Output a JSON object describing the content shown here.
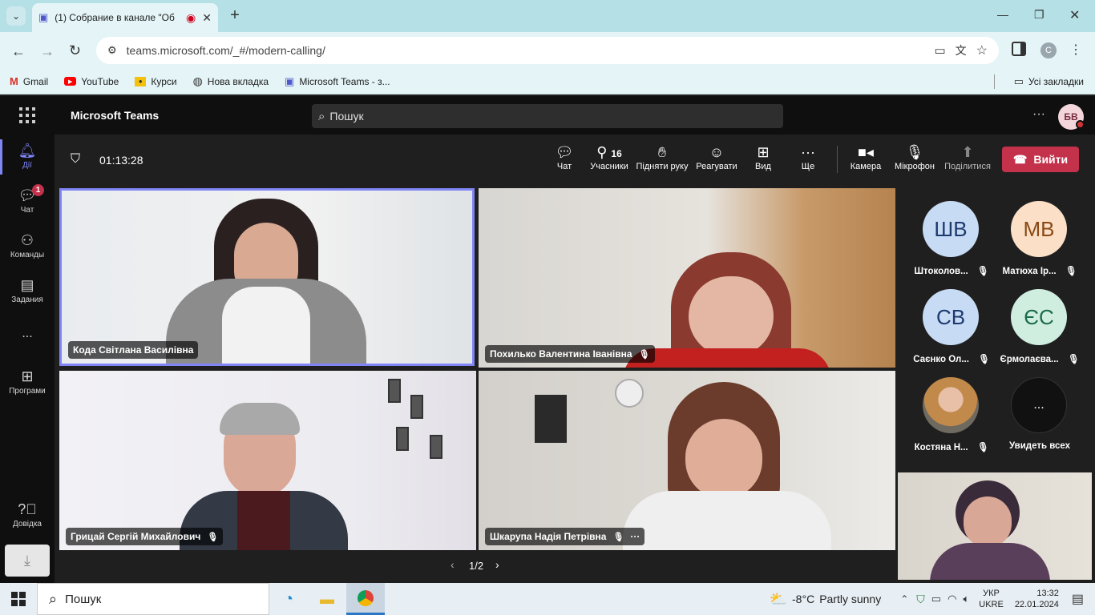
{
  "browser": {
    "tab_title": "(1) Собрание в канале \"Об",
    "new_tab": "+",
    "url": "teams.microsoft.com/_#/modern-calling/",
    "profile_initial": "C",
    "bookmarks": [
      "Gmail",
      "YouTube",
      "Курси",
      "Нова вкладка",
      "Microsoft Teams - з..."
    ],
    "all_bookmarks": "Усі закладки"
  },
  "teams": {
    "app_title": "Microsoft Teams",
    "search_placeholder": "Пошук",
    "user_initials": "БВ",
    "rail": [
      {
        "label": "Дії",
        "icon": "bell-icon"
      },
      {
        "label": "Чат",
        "icon": "chat-icon",
        "badge": "1"
      },
      {
        "label": "Команды",
        "icon": "teams-icon"
      },
      {
        "label": "Задания",
        "icon": "assignments-icon"
      },
      {
        "label": "...",
        "icon": "more-icon"
      },
      {
        "label": "Програми",
        "icon": "apps-icon"
      },
      {
        "label": "Довідка",
        "icon": "help-icon"
      }
    ],
    "call": {
      "timer": "01:13:28",
      "participants_count": "16",
      "controls": [
        "Чат",
        "Учасники",
        "Підняти руку",
        "Реагувати",
        "Вид",
        "Ще",
        "Камера",
        "Мікрофон",
        "Поділитися"
      ],
      "leave": "Вийти"
    },
    "tiles": [
      {
        "name": "Кода Світлана Василівна",
        "muted": false
      },
      {
        "name": "Похилько Валентина Іванівна",
        "muted": true
      },
      {
        "name": "Грицай Сергій Михайлович",
        "muted": true
      },
      {
        "name": "Шкарупа Надія Петрівна",
        "muted": true
      }
    ],
    "pager": "1/2",
    "side": [
      {
        "initials": "ШВ",
        "name": "Штоколов...",
        "bg": "#c8dbf5",
        "fg": "#1c3a6e"
      },
      {
        "initials": "МВ",
        "name": "Матюха Ір...",
        "bg": "#fbe0c7",
        "fg": "#8a4a16"
      },
      {
        "initials": "СВ",
        "name": "Саєнко Ол...",
        "bg": "#c8dbf5",
        "fg": "#1c3a6e"
      },
      {
        "initials": "ЄС",
        "name": "Єрмолаєва...",
        "bg": "#cfeee0",
        "fg": "#1d6b4a"
      },
      {
        "initials": "",
        "name": "Костяна Н...",
        "bg": "#c9a27a",
        "fg": "#fff"
      },
      {
        "initials": "...",
        "name": "Увидеть всех",
        "bg": "#111111",
        "fg": "#fff"
      }
    ]
  },
  "taskbar": {
    "search": "Пошук",
    "weather_temp": "-8°C",
    "weather_text": "Partly sunny",
    "lang1": "УКР",
    "lang2": "UKRE",
    "time": "13:32",
    "date": "22.01.2024"
  }
}
